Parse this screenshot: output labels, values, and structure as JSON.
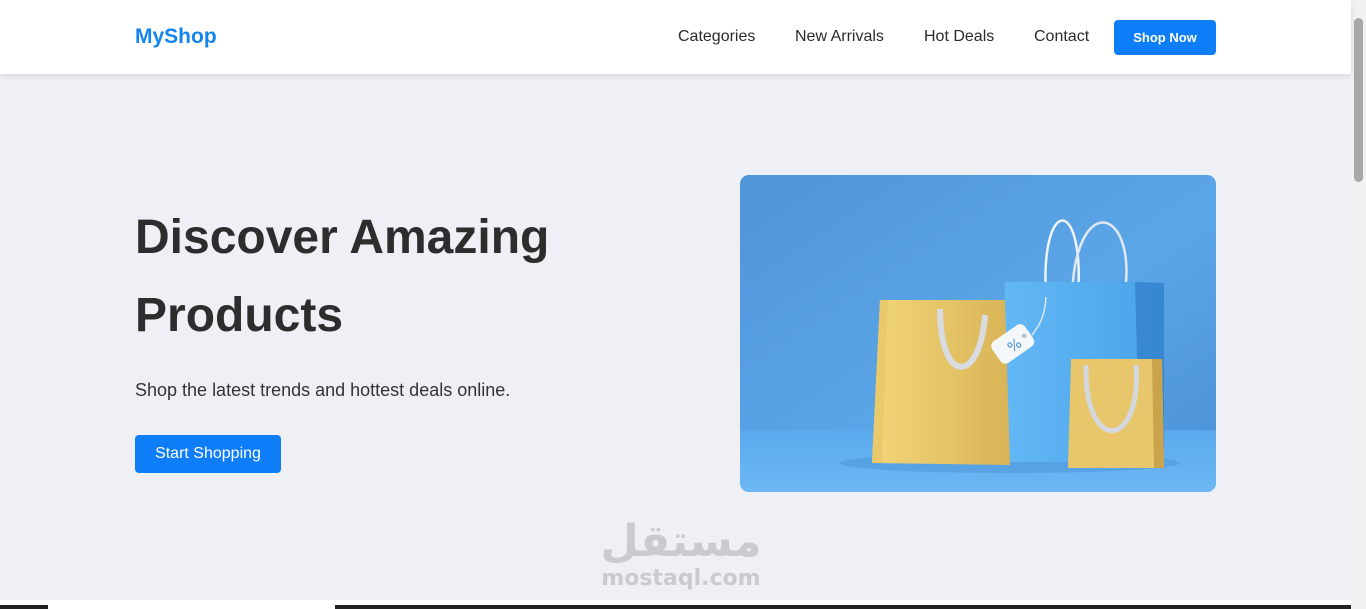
{
  "brand": {
    "name": "MyShop",
    "color": "#1585ee"
  },
  "nav": {
    "links": [
      {
        "label": "Categories"
      },
      {
        "label": "New Arrivals"
      },
      {
        "label": "Hot Deals"
      },
      {
        "label": "Contact"
      }
    ],
    "cta_label": "Shop Now"
  },
  "hero": {
    "title": "Discover Amazing Products",
    "subtitle": "Shop the latest trends and hottest deals online.",
    "button_label": "Start Shopping",
    "image_icon": "shopping-bags-illustration",
    "tag_symbol": "%"
  },
  "watermark": {
    "arabic": "مستقل",
    "latin": "mostaql.com"
  },
  "colors": {
    "accent": "#0d7ef8",
    "page_bg": "#eef0f5",
    "text": "#2d2d2d"
  }
}
